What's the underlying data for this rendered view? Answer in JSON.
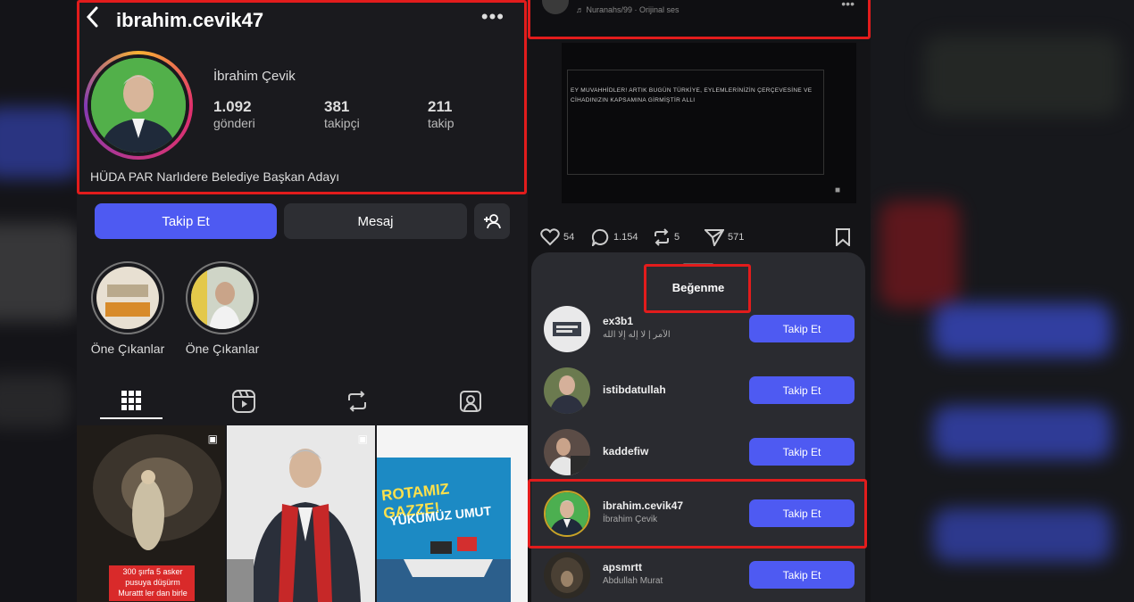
{
  "profile": {
    "username": "ibrahim.cevik47",
    "full_name": "İbrahim Çevik",
    "bio": "HÜDA PAR Narlıdere Belediye Başkan Adayı",
    "stats": [
      {
        "value": "1.092",
        "label": "gönderi"
      },
      {
        "value": "381",
        "label": "takipçi"
      },
      {
        "value": "211",
        "label": "takip"
      }
    ],
    "buttons": {
      "follow": "Takip Et",
      "message": "Mesaj"
    },
    "highlights": [
      {
        "label": "Öne Çıkanlar"
      },
      {
        "label": "Öne Çıkanlar"
      }
    ],
    "tab_icons": [
      "grid-icon",
      "reels-icon",
      "reposts-icon",
      "tagged-icon"
    ],
    "posts": [
      {
        "caption": "300 şırfa 5 asker\npusuya düşürm\nMurattt ler dan birle"
      },
      {
        "caption": ""
      },
      {
        "caption_top": "ROTAMIZ GAZZE!",
        "caption_bottom": "YÜKÜMÜZ UMUT"
      }
    ]
  },
  "reel": {
    "account_line": "Nuranahs/99 · Orijinal ses",
    "text": "EY MUVAHHİDLER! ARTIK BUGÜN TÜRKİYE, EYLEMLERİNİZİN ÇERÇEVESİNE VE CİHADINIZIN KAPSAMINA GİRMİŞTİR ALLI",
    "actions": {
      "likes": "54",
      "comments": "1.154",
      "reposts": "5",
      "shares": "571"
    }
  },
  "likes_sheet": {
    "title": "Beğenme",
    "follow_label": "Takip Et",
    "users": [
      {
        "username": "ex3b1",
        "subtitle": "الآمر | لا إله إلا الله",
        "avatar_color": "#e9e9ea"
      },
      {
        "username": "istibdatullah",
        "subtitle": "",
        "avatar_color": "#6b7a4f"
      },
      {
        "username": "kaddefiw",
        "subtitle": "",
        "avatar_color": "#5b4c46"
      },
      {
        "username": "ibrahim.cevik47",
        "subtitle": "İbrahim Çevik",
        "avatar_color": "#4caf50"
      },
      {
        "username": "apsmrtt",
        "subtitle": "Abdullah Murat",
        "avatar_color": "#2e2a24"
      }
    ]
  },
  "colors": {
    "accent": "#4e5af2",
    "highlight_box": "#e21c1c",
    "background": "#1a1a1e"
  }
}
